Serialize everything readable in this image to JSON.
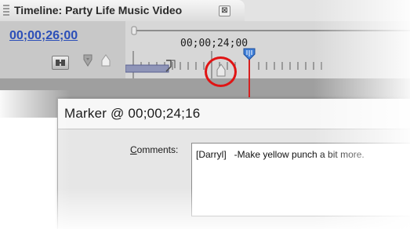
{
  "timeline": {
    "tab_title": "Timeline: Party Life Music Video",
    "tab_close_glyph": "⊠",
    "current_timecode": "00;00;26;00",
    "ruler_timecode": "00;00;24;00"
  },
  "marker_dialog": {
    "title": "Marker @ 00;00;24;16",
    "comments_label_mnemonic": "C",
    "comments_label_rest": "omments:",
    "comments_text": "[Darryl]   -Make yellow punch a bit more."
  },
  "colors": {
    "tab_accent": "#f4a420",
    "timecode_link": "#2c4fb8",
    "highlight_circle": "#e01414",
    "playhead": "#d62020"
  },
  "icons": [
    "snap-icon",
    "set-edit-point-icon",
    "set-marker-icon",
    "grip-icon",
    "close-icon",
    "playhead-icon",
    "marker-icon"
  ]
}
